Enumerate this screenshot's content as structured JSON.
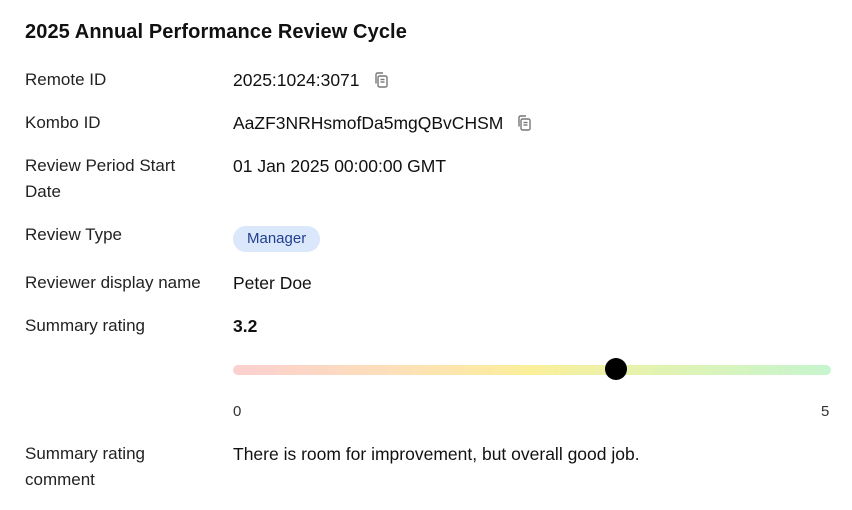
{
  "title": "2025 Annual Performance Review Cycle",
  "fields": {
    "remote_id": {
      "label": "Remote ID",
      "value": "2025:1024:3071"
    },
    "kombo_id": {
      "label": "Kombo ID",
      "value": "AaZF3NRHsmofDa5mgQBvCHSM"
    },
    "review_period_start": {
      "label": "Review Period Start Date",
      "value": "01 Jan 2025 00:00:00 GMT"
    },
    "review_type": {
      "label": "Review Type",
      "value": "Manager"
    },
    "reviewer": {
      "label": "Reviewer display name",
      "value": "Peter Doe"
    },
    "summary_rating": {
      "label": "Summary rating",
      "value": "3.2",
      "min": "0",
      "max": "5",
      "fraction": 0.64
    },
    "summary_comment": {
      "label": "Summary rating comment",
      "value": "There is room for improvement, but overall good job."
    }
  },
  "icons": {
    "copy": "copy-icon"
  },
  "colors": {
    "badge_bg": "#dbe8fb",
    "badge_text": "#1f3f8f",
    "thumb": "#000000"
  }
}
